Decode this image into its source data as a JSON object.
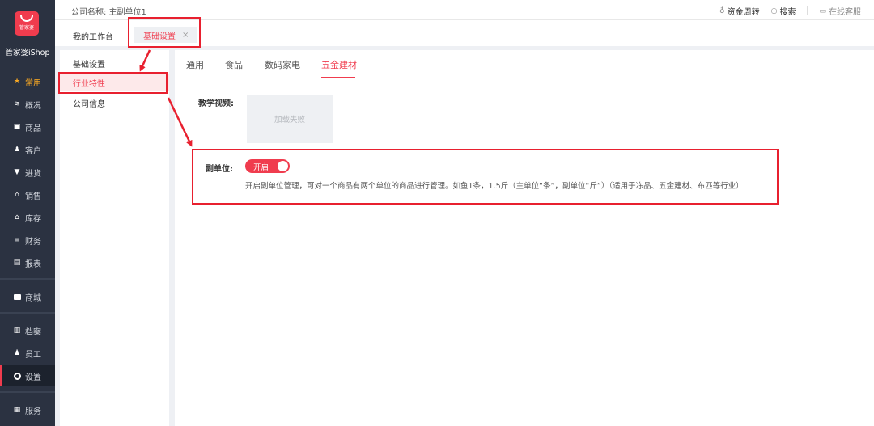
{
  "brand": {
    "logo_text": "管家婆",
    "name": "管家婆iShop"
  },
  "nav": {
    "items": [
      {
        "label": "常用",
        "icon": "star-icon"
      },
      {
        "label": "概况",
        "icon": "layers-icon"
      },
      {
        "label": "商品",
        "icon": "goods-icon"
      },
      {
        "label": "客户",
        "icon": "customer-icon"
      },
      {
        "label": "进货",
        "icon": "cart-icon"
      },
      {
        "label": "销售",
        "icon": "sales-icon"
      },
      {
        "label": "库存",
        "icon": "warehouse-icon"
      },
      {
        "label": "财务",
        "icon": "finance-icon"
      },
      {
        "label": "报表",
        "icon": "report-icon"
      },
      {
        "label": "商城",
        "icon": "mall-icon"
      },
      {
        "label": "档案",
        "icon": "archive-icon"
      },
      {
        "label": "员工",
        "icon": "staff-icon"
      },
      {
        "label": "设置",
        "icon": "settings-icon"
      },
      {
        "label": "服务",
        "icon": "service-icon"
      }
    ],
    "active": "常用",
    "selected": "设置"
  },
  "header": {
    "company": "公司名称: 主副单位1",
    "fund_flow": "资金周转",
    "search": "搜索",
    "online_service": "在线客服"
  },
  "tabs": {
    "home": "我的工作台",
    "active": "基础设置",
    "close": "×"
  },
  "side_menu": {
    "items": [
      "基础设置",
      "行业特性",
      "公司信息"
    ],
    "selected": "行业特性"
  },
  "subtabs": {
    "items": [
      "通用",
      "食品",
      "数码家电",
      "五金建材"
    ],
    "selected": "五金建材"
  },
  "content": {
    "video_label": "教学视频:",
    "video_placeholder": "加载失败",
    "sub_unit_label": "副单位:",
    "toggle_text": "开启",
    "toggle_on": true,
    "description": "开启副单位管理，可对一个商品有两个单位的商品进行管理。如鱼1条，1.5斤（主单位“条”，副单位“斤”）（适用于冻品、五金建材、布匹等行业）"
  },
  "colors": {
    "accent": "#f03c4e",
    "nav_bg": "#2b3241",
    "highlight_outline": "#e8202f"
  }
}
